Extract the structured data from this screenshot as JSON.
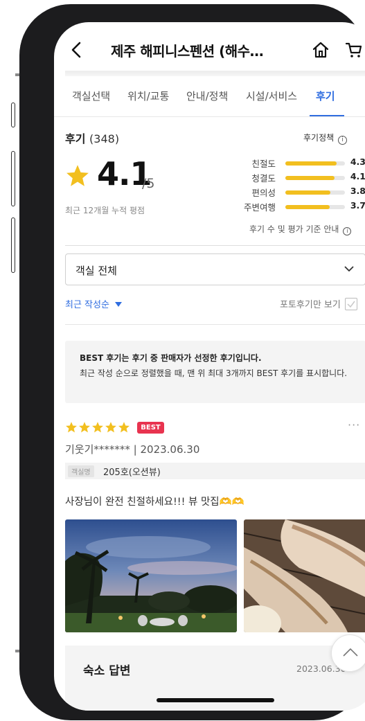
{
  "header": {
    "title": "제주 해피니스펜션 (해수…",
    "back_icon": "chevron-left-icon",
    "home_icon": "home-icon",
    "cart_icon": "cart-icon"
  },
  "tabs": [
    {
      "label": "객실선택",
      "active": false
    },
    {
      "label": "위치/교통",
      "active": false
    },
    {
      "label": "안내/정책",
      "active": false
    },
    {
      "label": "시설/서비스",
      "active": false
    },
    {
      "label": "후기",
      "active": true
    }
  ],
  "review_summary": {
    "title": "후기",
    "count": "(348)",
    "policy_label": "후기정책",
    "score": "4.1",
    "score_max": "/5",
    "period": "최근 12개월 누적 평점",
    "bars": [
      {
        "label": "친절도",
        "value": "4.3",
        "fraction": 0.86
      },
      {
        "label": "청결도",
        "value": "4.1",
        "fraction": 0.82
      },
      {
        "label": "편의성",
        "value": "3.8",
        "fraction": 0.76
      },
      {
        "label": "주변여행",
        "value": "3.7",
        "fraction": 0.74
      }
    ],
    "basis_note": "후기 수 및 평가 기준 안내"
  },
  "filters": {
    "room_dropdown": "객실 전체",
    "sort_label": "최근 작성순",
    "photo_only_label": "포토후기만 보기"
  },
  "best_notice": {
    "line1": "BEST 후기는 후기 중 판매자가 선정한 후기입니다.",
    "line2": "최근 작성 순으로 정렬했을 때, 맨 위 최대 3개까지 BEST 후기를 표시합니다."
  },
  "review": {
    "rating": 5,
    "badge": "BEST",
    "author_date": "기웃기******* | 2023.06.30",
    "room_tag": "객실명",
    "room_name": "205호(오션뷰)",
    "text": "사장님이 완전 친절하세요!!! 뷰 맛집🫶🫶",
    "more": "···"
  },
  "reply": {
    "title": "숙소 답변",
    "date": "2023.06.30"
  },
  "colors": {
    "accent": "#2f6de0",
    "star": "#f2bf1f",
    "badge": "#e8334f",
    "frame": "#1c1c1e"
  }
}
